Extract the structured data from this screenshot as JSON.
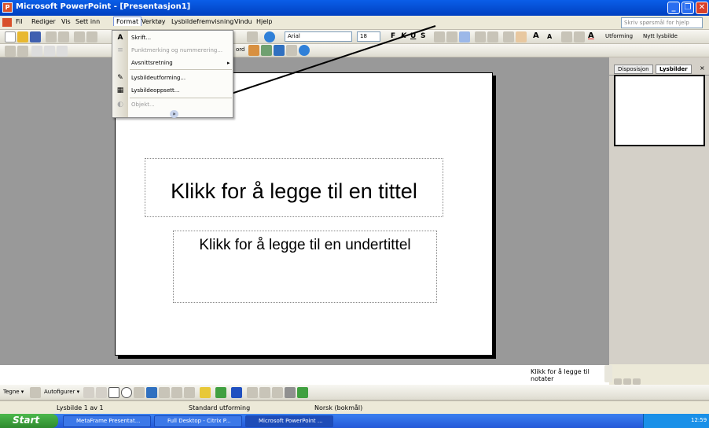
{
  "window": {
    "title": "Microsoft PowerPoint - [Presentasjon1]",
    "app_icon_letter": "P"
  },
  "menubar": {
    "items": [
      "Fil",
      "Rediger",
      "Vis",
      "Sett inn",
      "Format",
      "Verktøy",
      "Lysbildefremvisning",
      "Vindu",
      "Hjelp"
    ],
    "help_placeholder": "Skriv spørsmål for hjelp"
  },
  "toolbar": {
    "font_name": "Arial",
    "font_size": "18",
    "bold": "F",
    "italic": "K",
    "underline": "U",
    "shadow": "S",
    "design_label": "Utforming",
    "new_slide_label": "Nytt lysbilde",
    "word_fragment": "ord"
  },
  "format_menu": {
    "items": [
      {
        "label": "Skrift...",
        "icon": "A",
        "disabled": false
      },
      {
        "label": "Punktmerking og nummerering...",
        "icon": "≡",
        "disabled": true
      },
      {
        "label": "Avsnittsretning",
        "icon": "",
        "disabled": false,
        "submenu": true
      },
      {
        "label": "Lysbildeutforming...",
        "icon": "✎",
        "disabled": false
      },
      {
        "label": "Lysbildeoppsett...",
        "icon": "▦",
        "disabled": false
      },
      {
        "label": "Objekt...",
        "icon": "◐",
        "disabled": true
      }
    ],
    "expand_glyph": "»"
  },
  "slide": {
    "title_placeholder": "Klikk for å legge til en tittel",
    "subtitle_placeholder": "Klikk for å legge til en undertittel"
  },
  "right_pane": {
    "tabs": [
      "Disposisjon",
      "Lysbilder"
    ],
    "close_glyph": "×"
  },
  "notes": {
    "placeholder": "Klikk for å legge til notater"
  },
  "drawbar": {
    "draw_label": "Tegne ▾",
    "autoshapes_label": "Autofigurer ▾"
  },
  "statusbar": {
    "slide_count": "Lysbilde 1 av 1",
    "design": "Standard utforming",
    "language": "Norsk (bokmål)"
  },
  "taskbar": {
    "start_label": "Start",
    "tasks": [
      "MetaFrame Presentat...",
      "Full Desktop - Citrix P...",
      "Microsoft PowerPoint ..."
    ],
    "clock": "12:59"
  },
  "colors": {
    "titlebar": "#0a5ee8",
    "workarea": "#999999",
    "taskbar": "#2458d8",
    "start": "#2e8a2e"
  }
}
